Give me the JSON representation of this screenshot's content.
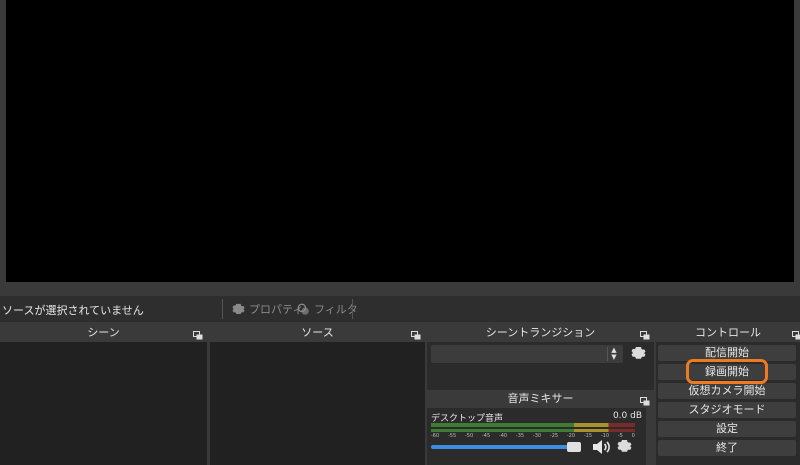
{
  "source_toolbar": {
    "no_source": "ソースが選択されていません",
    "properties": "プロパティ",
    "filters": "フィルタ"
  },
  "docks": {
    "scenes": "シーン",
    "sources": "ソース",
    "transitions": "シーントランジション",
    "controls": "コントロール"
  },
  "mixer": {
    "title": "音声ミキサー",
    "channel": "デスクトップ音声",
    "level": "0.0 dB",
    "ticks": [
      "-60",
      "-55",
      "-50",
      "-45",
      "-40",
      "-35",
      "-30",
      "-25",
      "-20",
      "-15",
      "-10",
      "-5",
      "0"
    ]
  },
  "controls": {
    "start_streaming": "配信開始",
    "start_recording": "録画開始",
    "start_virtual_camera": "仮想カメラ開始",
    "studio_mode": "スタジオモード",
    "settings": "設定",
    "exit": "終了"
  },
  "colors": {
    "highlight": "#ee7a22",
    "volume": "#3c8de0"
  }
}
